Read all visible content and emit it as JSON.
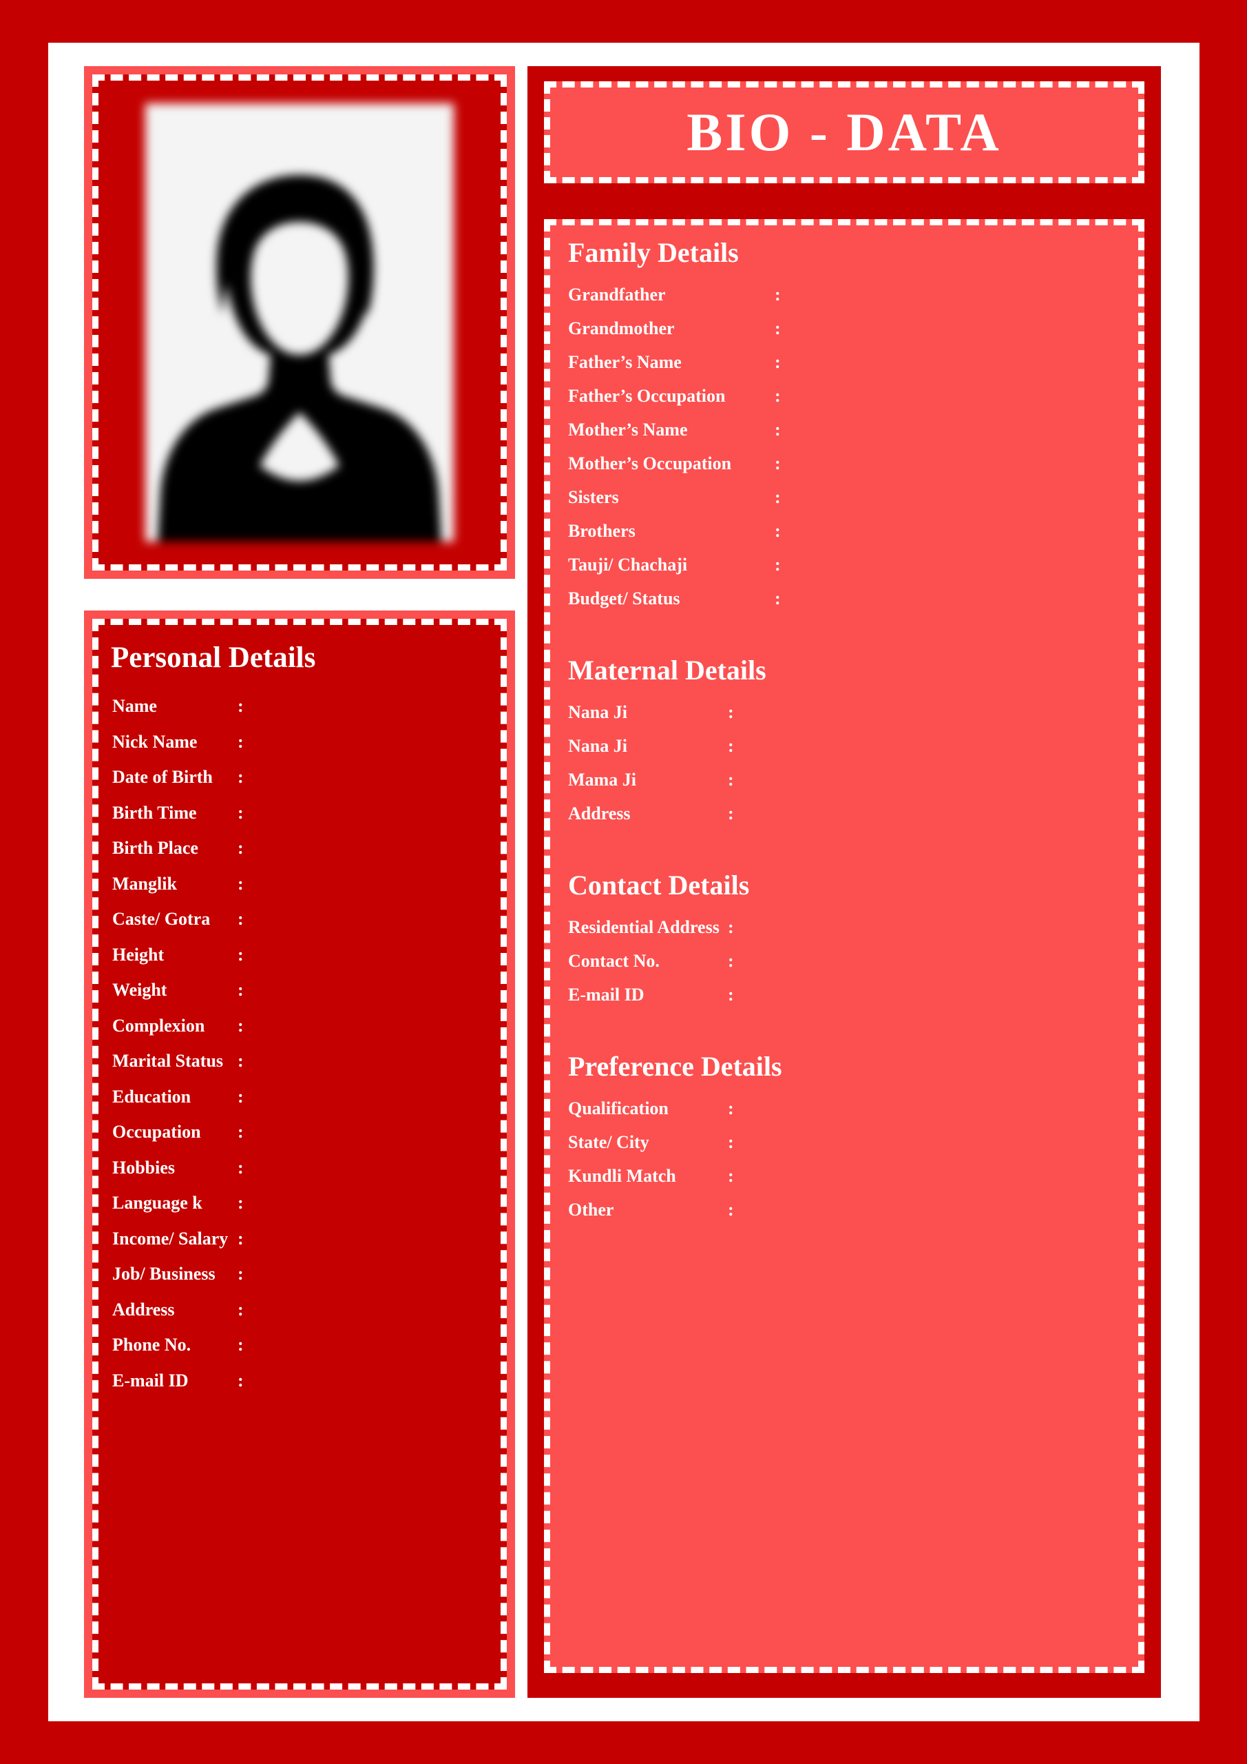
{
  "document": {
    "title": "BIO - DATA",
    "colors": {
      "outer_red": "#C40000",
      "coral": "#FC4F4F",
      "paper_white": "#FFFFFF",
      "text_white": "#FFFFFF"
    }
  },
  "photo": {
    "alt": "female-silhouette-placeholder"
  },
  "personal": {
    "heading": "Personal Details",
    "rows": [
      {
        "label": "Name",
        "colon": ":",
        "value": ""
      },
      {
        "label": "Nick Name",
        "colon": ":",
        "value": ""
      },
      {
        "label": "Date of Birth",
        "colon": ":",
        "value": ""
      },
      {
        "label": "Birth Time",
        "colon": ":",
        "value": ""
      },
      {
        "label": "Birth Place",
        "colon": ":",
        "value": ""
      },
      {
        "label": "Manglik",
        "colon": ":",
        "value": ""
      },
      {
        "label": "Caste/ Gotra",
        "colon": ":",
        "value": ""
      },
      {
        "label": "Height",
        "colon": ":",
        "value": ""
      },
      {
        "label": "Weight",
        "colon": ":",
        "value": ""
      },
      {
        "label": "Complexion",
        "colon": ":",
        "value": ""
      },
      {
        "label": "Marital Status",
        "colon": ":",
        "value": ""
      },
      {
        "label": "Education",
        "colon": ":",
        "value": ""
      },
      {
        "label": "Occupation",
        "colon": ":",
        "value": ""
      },
      {
        "label": "Hobbies",
        "colon": ":",
        "value": ""
      },
      {
        "label": "Language k",
        "colon": ":",
        "value": ""
      },
      {
        "label": "Income/ Salary",
        "colon": ":",
        "value": ""
      },
      {
        "label": "Job/ Business",
        "colon": ":",
        "value": ""
      },
      {
        "label": "Address",
        "colon": ":",
        "value": ""
      },
      {
        "label": "Phone No.",
        "colon": ":",
        "value": ""
      },
      {
        "label": "E-mail ID",
        "colon": ":",
        "value": ""
      }
    ]
  },
  "family": {
    "heading": "Family Details",
    "rows": [
      {
        "label": "Grandfather",
        "colon": ":",
        "value": ""
      },
      {
        "label": "Grandmother",
        "colon": ":",
        "value": ""
      },
      {
        "label": "Father’s Name",
        "colon": ":",
        "value": ""
      },
      {
        "label": "Father’s Occupation",
        "colon": ":",
        "value": ""
      },
      {
        "label": "Mother’s Name",
        "colon": ":",
        "value": ""
      },
      {
        "label": "Mother’s Occupation",
        "colon": ":",
        "value": ""
      },
      {
        "label": "Sisters",
        "colon": ":",
        "value": ""
      },
      {
        "label": "Brothers",
        "colon": ":",
        "value": ""
      },
      {
        "label": "Tauji/ Chachaji",
        "colon": ":",
        "value": ""
      },
      {
        "label": "Budget/ Status",
        "colon": ":",
        "value": ""
      }
    ]
  },
  "maternal": {
    "heading": "Maternal Details",
    "rows": [
      {
        "label": "Nana Ji",
        "colon": ":",
        "value": ""
      },
      {
        "label": "Nana Ji",
        "colon": ":",
        "value": ""
      },
      {
        "label": "Mama Ji",
        "colon": ":",
        "value": ""
      },
      {
        "label": "Address",
        "colon": ":",
        "value": ""
      }
    ]
  },
  "contact": {
    "heading": "Contact Details",
    "rows": [
      {
        "label": "Residential Address",
        "colon": ":",
        "value": ""
      },
      {
        "label": "Contact No.",
        "colon": ":",
        "value": ""
      },
      {
        "label": "E-mail ID",
        "colon": ":",
        "value": ""
      }
    ]
  },
  "preference": {
    "heading": "Preference Details",
    "rows": [
      {
        "label": "Qualification",
        "colon": ":",
        "value": ""
      },
      {
        "label": "State/ City",
        "colon": ":",
        "value": ""
      },
      {
        "label": "Kundli Match",
        "colon": ":",
        "value": ""
      },
      {
        "label": "Other",
        "colon": ":",
        "value": ""
      }
    ]
  }
}
